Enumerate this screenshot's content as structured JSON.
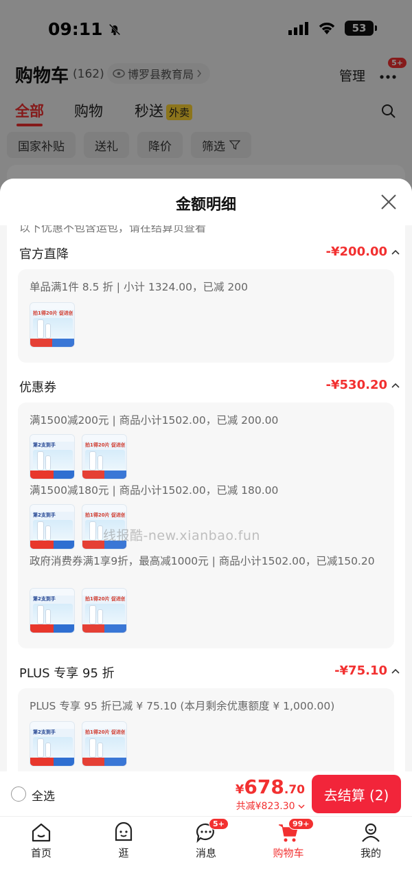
{
  "status": {
    "time": "09:11",
    "battery": "53"
  },
  "cart": {
    "title": "购物车",
    "count": "(162)",
    "location": "博罗县教育局",
    "manage": "管理",
    "more_badge": "5+",
    "tabs": [
      "全部",
      "购物",
      "秒送"
    ],
    "waimai": "外卖",
    "filters": [
      "国家补贴",
      "送礼",
      "降价",
      "筛选"
    ]
  },
  "sheet": {
    "title": "金额明细",
    "cut_text": "以下优惠不包含运包，请在结算页查看",
    "sections": [
      {
        "title": "官方直降",
        "amount": "-¥200.00",
        "lines": [
          "单品满1件 8.5 折 | 小计 1324.00，已减 200"
        ]
      },
      {
        "title": "优惠券",
        "amount": "-¥530.20",
        "lines": [
          "满1500减200元 | 商品小计1502.00，已减 200.00",
          "满1500减180元 | 商品小计1502.00，已减 180.00",
          "政府消费券满1享9折，最高减1000元 | 商品小计1502.00，已减150.20"
        ]
      },
      {
        "title": "PLUS 专享 95 折",
        "amount": "-¥75.10",
        "lines": [
          "PLUS 专享 95 折已减 ¥ 75.10 (本月剩余优惠额度 ¥ 1,000.00)"
        ]
      }
    ],
    "thumb_text_a": "第2支到手",
    "thumb_text_b": "拍1得20片 促进创面愈合",
    "watermark": "线报酷-new.xianbao.fun"
  },
  "checkout": {
    "select_all": "全选",
    "price_yen": "¥",
    "price_int": "678",
    "price_dec": ".70",
    "discount": "共减¥823.30",
    "button": "去结算 (2)"
  },
  "tabbar": {
    "items": [
      "首页",
      "逛",
      "消息",
      "购物车",
      "我的"
    ],
    "message_badge": "5+",
    "cart_badge": "99+"
  },
  "colors": {
    "accent": "#f23030",
    "checkout": "#f2253a"
  }
}
